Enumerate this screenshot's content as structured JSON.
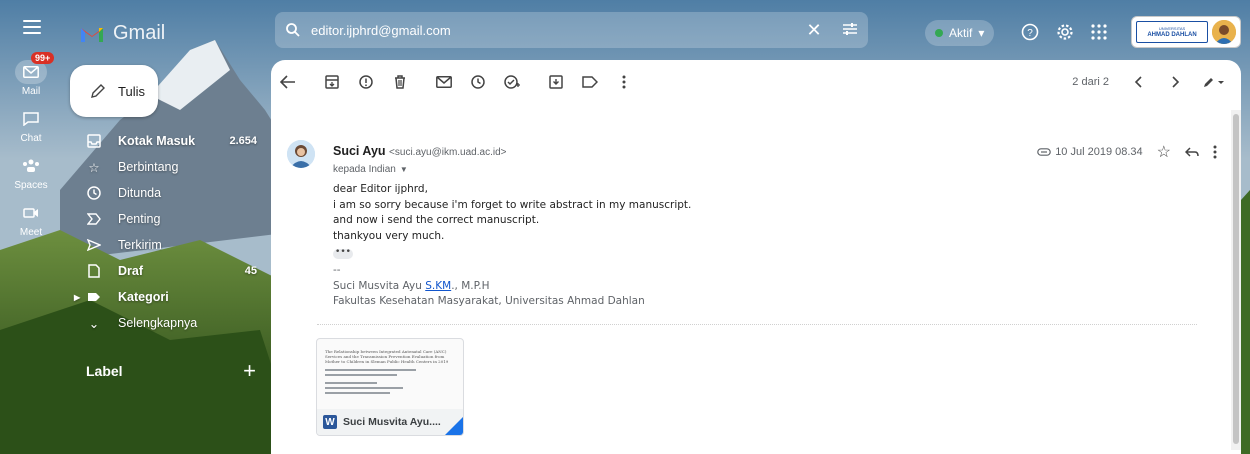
{
  "app": {
    "name": "Gmail"
  },
  "search": {
    "value": "editor.ijphrd@gmail.com"
  },
  "status": {
    "label": "Aktif"
  },
  "account": {
    "org_top": "UNIVERSITAS",
    "org_name": "AHMAD DAHLAN"
  },
  "rail": [
    {
      "label": "Mail",
      "badge": "99+"
    },
    {
      "label": "Chat"
    },
    {
      "label": "Spaces"
    },
    {
      "label": "Meet"
    }
  ],
  "compose": {
    "label": "Tulis"
  },
  "nav": [
    {
      "label": "Kotak Masuk",
      "count": "2.654",
      "bold": true
    },
    {
      "label": "Berbintang",
      "count": ""
    },
    {
      "label": "Ditunda",
      "count": ""
    },
    {
      "label": "Penting",
      "count": ""
    },
    {
      "label": "Terkirim",
      "count": ""
    },
    {
      "label": "Draf",
      "count": "45",
      "bold": true
    },
    {
      "label": "Kategori",
      "count": "",
      "bold": true
    },
    {
      "label": "Selengkapnya",
      "count": ""
    }
  ],
  "labels_header": "Label",
  "pager": {
    "text": "2 dari 2"
  },
  "message": {
    "sender_name": "Suci Ayu",
    "sender_email": "<suci.ayu@ikm.uad.ac.id>",
    "to": "kepada Indian",
    "date": "10 Jul 2019 08.34",
    "lines": [
      "dear Editor ijphrd,",
      "i am so sorry because i'm forget to write abstract in my manuscript.",
      "and now i send the correct manuscript.",
      "thankyou very much."
    ],
    "sig_dash": "--",
    "sig_name_pre": "Suci Musvita Ayu ",
    "sig_name_link": "S.KM",
    "sig_name_post": "., M.P.H",
    "sig_org": "Fakultas Kesehatan Masyarakat, Universitas Ahmad Dahlan",
    "ellipsis": "•••"
  },
  "attachment": {
    "name": "Suci Musvita Ayu....",
    "type_letter": "W",
    "preview_title": "The Relationship between Integrated Antenatal Care (ANC) Services and the Transmission Prevention Evaluation from Mother to Children in Sleman Public Health Centers in 2019"
  },
  "colors": {
    "accent_blue": "#1a73e8",
    "badge_red": "#d93025",
    "online_green": "#34a853"
  }
}
